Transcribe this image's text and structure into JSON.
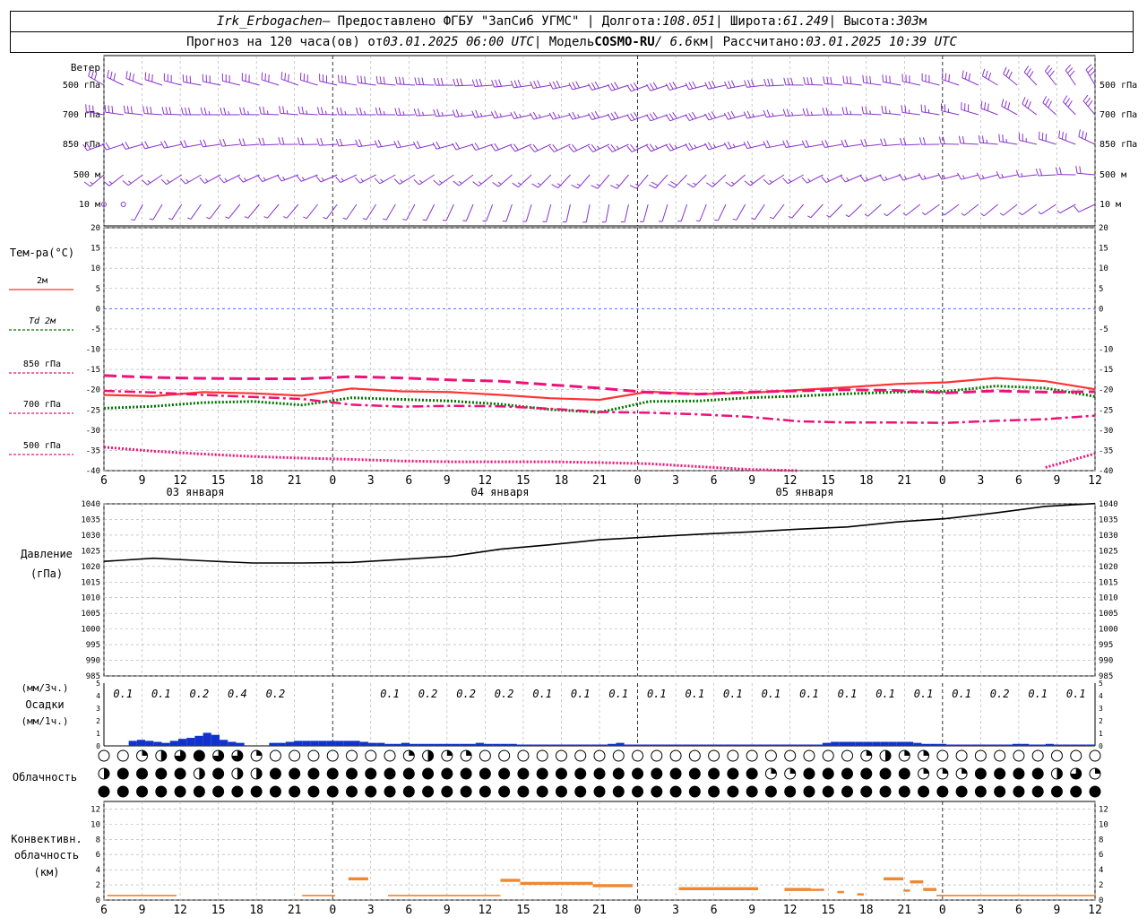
{
  "header": {
    "station": "Irk_Erbogachen",
    "provider_prefix": " – Предоставлено ФГБУ \"ЗапСиб УГМС\" | Долгота: ",
    "longitude": "108.051",
    "lat_prefix": " | Широта: ",
    "latitude": "61.249",
    "alt_prefix": " | Высота: ",
    "altitude": "303",
    "alt_unit": "м",
    "forecast_prefix": "Прогноз на 120 часа(ов) от ",
    "forecast_start": "03.01.2025 06:00 UTC",
    "model_prefix": " | Модель ",
    "model": "COSMO-RU",
    "resolution": " / 6.6",
    "res_unit": "км",
    "calc_prefix": " | Рассчитано: ",
    "calc_time": "03.01.2025 10:39 UTC"
  },
  "labels": {
    "wind": "Ветер",
    "levels": [
      "500 гПа",
      "700 гПа",
      "850 гПа",
      "500 м",
      "10 м"
    ],
    "temp_title": "Тем-ра(°C)",
    "legend": [
      {
        "label": "2м",
        "color": "#ff3333",
        "dash": "solid"
      },
      {
        "label": "Td 2м",
        "color": "#007700",
        "dash": "dotted"
      },
      {
        "label": "850 гПа",
        "color": "#ee1177",
        "dash": "dash"
      },
      {
        "label": "700 гПа",
        "color": "#ee1177",
        "dash": "dashdot"
      },
      {
        "label": "500 гПа",
        "color": "#ee1177",
        "dash": "dot"
      }
    ],
    "pressure_title": "Давление",
    "pressure_unit": "(гПа)",
    "precip_unit3": "(мм/3ч.)",
    "precip_title": "Осадки",
    "precip_unit1": "(мм/1ч.)",
    "cloud_title": "Облачность",
    "conv_title1": "Конвективн.",
    "conv_title2": "облачность",
    "conv_unit": "(км)"
  },
  "time_axis": {
    "ticks": [
      "6",
      "9",
      "12",
      "15",
      "18",
      "21",
      "0",
      "3",
      "6",
      "9",
      "12",
      "15",
      "18",
      "21",
      "0",
      "3",
      "6",
      "9",
      "12",
      "15",
      "18",
      "21",
      "0",
      "3",
      "6",
      "9",
      "12"
    ],
    "dates": [
      "03 января",
      "04 января",
      "05 января"
    ]
  },
  "chart_data": [
    {
      "type": "line",
      "name": "temperature",
      "ylim": [
        -40,
        20
      ],
      "yticks": [
        20,
        15,
        10,
        5,
        0,
        -5,
        -10,
        -15,
        -20,
        -25,
        -30,
        -35,
        -40
      ],
      "hours": [
        0,
        6,
        12,
        18,
        24,
        30,
        36,
        42,
        48,
        54,
        60,
        66,
        72,
        78,
        84,
        90,
        96,
        102,
        108,
        114,
        120
      ],
      "series": [
        {
          "name": "2м",
          "values": [
            -21.3,
            -21.6,
            -20.6,
            -20.9,
            -21.5,
            -19.7,
            -20.4,
            -20.6,
            -21.3,
            -22.1,
            -22.5,
            -20.5,
            -21.1,
            -20.8,
            -20.1,
            -19.4,
            -18.6,
            -18.2,
            -17.1,
            -17.9,
            -19.9
          ]
        },
        {
          "name": "Td 2м",
          "values": [
            -24.6,
            -24.1,
            -23.2,
            -22.9,
            -23.8,
            -22.0,
            -22.4,
            -22.8,
            -23.6,
            -24.9,
            -25.6,
            -22.9,
            -22.8,
            -22.0,
            -21.6,
            -21.0,
            -20.6,
            -20.4,
            -19.1,
            -19.6,
            -21.7
          ]
        },
        {
          "name": "850 гПа",
          "values": [
            -16.5,
            -17.0,
            -17.2,
            -17.3,
            -17.3,
            -16.8,
            -17.1,
            -17.6,
            -17.9,
            -18.8,
            -19.6,
            -20.7,
            -21.1,
            -20.6,
            -20.3,
            -20.0,
            -20.2,
            -20.8,
            -20.3,
            -20.6,
            -20.5
          ]
        },
        {
          "name": "700 гПа",
          "values": [
            -20.3,
            -20.7,
            -21.3,
            -21.8,
            -22.3,
            -23.7,
            -24.2,
            -24.0,
            -24.1,
            -24.7,
            -25.5,
            -25.7,
            -26.1,
            -26.7,
            -27.8,
            -28.1,
            -28.1,
            -28.2,
            -27.7,
            -27.3,
            -26.4
          ]
        },
        {
          "name": "500 гПа",
          "values": [
            -34.2,
            -35.2,
            -35.9,
            -36.5,
            -36.9,
            -37.2,
            -37.6,
            -37.8,
            -37.8,
            -37.8,
            -38.0,
            -38.3,
            -39.0,
            -39.7,
            -40.2,
            null,
            null,
            null,
            null,
            -39.2,
            -35.8
          ]
        }
      ]
    },
    {
      "type": "line",
      "name": "pressure",
      "ylim": [
        985,
        1040
      ],
      "yticks": [
        1040,
        1035,
        1030,
        1025,
        1020,
        1015,
        1010,
        1005,
        1000,
        995,
        990,
        985
      ],
      "hours": [
        0,
        6,
        12,
        18,
        24,
        30,
        36,
        42,
        48,
        54,
        60,
        66,
        72,
        78,
        84,
        90,
        96,
        102,
        108,
        114,
        120
      ],
      "values": [
        1021.6,
        1022.6,
        1021.8,
        1021.1,
        1021.1,
        1021.3,
        1022.2,
        1023.2,
        1025.5,
        1026.9,
        1028.5,
        1029.4,
        1030.3,
        1031.0,
        1031.9,
        1032.6,
        1034.2,
        1035.3,
        1037.1,
        1039.2,
        1040.1
      ]
    },
    {
      "type": "bar",
      "name": "precipitation",
      "ylim": [
        0,
        5
      ],
      "yticks": [
        5,
        4,
        3,
        2,
        1,
        0
      ],
      "three_hour_totals": [
        "0.1",
        "0.1",
        "0.2",
        "0.4",
        "0.2",
        "",
        "",
        "0.1",
        "0.2",
        "0.2",
        "0.2",
        "0.1",
        "0.1",
        "0.1",
        "0.1",
        "0.1",
        "0.1",
        "0.1",
        "0.1",
        "0.1",
        "0.1",
        "0.1",
        "0.1",
        "0.2",
        "0.1",
        "0.1"
      ],
      "hourly_mm": [
        0,
        0,
        0,
        0.05,
        0.06,
        0.05,
        0.04,
        0.03,
        0.05,
        0.07,
        0.08,
        0.1,
        0.13,
        0.11,
        0.06,
        0.04,
        0.03,
        0,
        0,
        0,
        0.03,
        0.03,
        0.04,
        0.05,
        0.05,
        0.05,
        0.05,
        0.05,
        0.05,
        0.05,
        0.05,
        0.04,
        0.03,
        0.03,
        0.02,
        0.02,
        0.03,
        0.02,
        0.02,
        0.02,
        0.02,
        0.02,
        0.02,
        0.02,
        0.02,
        0.03,
        0.02,
        0.02,
        0.02,
        0.02,
        0.01,
        0.01,
        0.01,
        0.01,
        0.01,
        0.01,
        0.01,
        0.01,
        0.01,
        0.01,
        0.01,
        0.02,
        0.03,
        0.01,
        0.01,
        0.01,
        0.01,
        0.01,
        0.01,
        0.01,
        0.01,
        0.01,
        0.01,
        0.01,
        0.01,
        0.01,
        0.01,
        0.01,
        0.01,
        0.01,
        0.01,
        0.01,
        0.01,
        0.01,
        0.01,
        0.01,
        0.01,
        0.03,
        0.04,
        0.04,
        0.04,
        0.04,
        0.04,
        0.04,
        0.04,
        0.04,
        0.04,
        0.04,
        0.03,
        0.02,
        0.02,
        0.02,
        0.01,
        0.01,
        0.01,
        0.01,
        0.01,
        0.01,
        0.01,
        0.01,
        0.02,
        0.02,
        0.01,
        0.01,
        0.02,
        0.01,
        0.01,
        0.01,
        0.01,
        0.01
      ]
    },
    {
      "type": "table",
      "name": "cloudiness",
      "levels": [
        "high",
        "mid",
        "low"
      ],
      "count": 53,
      "legend": "0 clear, 1 quarter, 2 half, 3 three-quarter, 4 overcast",
      "high": [
        0,
        0,
        1,
        2,
        3,
        4,
        3,
        3,
        1,
        0,
        0,
        0,
        0,
        0,
        0,
        0,
        1,
        2,
        1,
        1,
        0,
        0,
        0,
        0,
        0,
        0,
        0,
        0,
        0,
        0,
        0,
        0,
        0,
        0,
        0,
        0,
        0,
        0,
        0,
        0,
        1,
        2,
        1,
        1,
        0,
        0,
        0,
        0,
        0,
        0,
        0,
        0,
        0
      ],
      "mid": [
        2,
        4,
        4,
        4,
        4,
        2,
        4,
        2,
        2,
        4,
        4,
        4,
        4,
        4,
        4,
        4,
        4,
        4,
        4,
        4,
        4,
        4,
        4,
        4,
        4,
        4,
        4,
        4,
        4,
        4,
        4,
        4,
        4,
        4,
        4,
        1,
        1,
        4,
        4,
        4,
        4,
        4,
        4,
        1,
        1,
        1,
        4,
        4,
        4,
        4,
        2,
        3,
        1
      ],
      "low": [
        4,
        4,
        4,
        4,
        4,
        4,
        4,
        4,
        4,
        4,
        4,
        4,
        4,
        4,
        4,
        4,
        4,
        4,
        4,
        4,
        4,
        4,
        4,
        4,
        4,
        4,
        4,
        4,
        4,
        4,
        4,
        4,
        4,
        4,
        4,
        4,
        4,
        4,
        4,
        4,
        4,
        4,
        4,
        4,
        4,
        4,
        4,
        4,
        4,
        4,
        4,
        4,
        4
      ]
    },
    {
      "type": "bar",
      "name": "convective_cloud",
      "ylim": [
        0,
        13
      ],
      "yticks": [
        12,
        10,
        8,
        6,
        4,
        2,
        0
      ],
      "segments": [
        {
          "from": 0.5,
          "to": 11,
          "base": 0.5,
          "top": 0.7
        },
        {
          "from": 30,
          "to": 35,
          "base": 0.5,
          "top": 0.7
        },
        {
          "from": 37,
          "to": 40,
          "base": 2.6,
          "top": 3.0
        },
        {
          "from": 43,
          "to": 60,
          "base": 0.5,
          "top": 0.7
        },
        {
          "from": 60,
          "to": 63,
          "base": 2.4,
          "top": 2.8
        },
        {
          "from": 63,
          "to": 74,
          "base": 2.0,
          "top": 2.4
        },
        {
          "from": 74,
          "to": 80,
          "base": 1.7,
          "top": 2.1
        },
        {
          "from": 87,
          "to": 99,
          "base": 1.3,
          "top": 1.7
        },
        {
          "from": 103,
          "to": 107,
          "base": 1.2,
          "top": 1.6
        },
        {
          "from": 107,
          "to": 109,
          "base": 1.2,
          "top": 1.5
        },
        {
          "from": 111,
          "to": 112,
          "base": 0.9,
          "top": 1.2
        },
        {
          "from": 114,
          "to": 115,
          "base": 0.6,
          "top": 0.9
        },
        {
          "from": 118,
          "to": 121,
          "base": 2.6,
          "top": 3.0
        },
        {
          "from": 121,
          "to": 122,
          "base": 1.1,
          "top": 1.4
        },
        {
          "from": 122,
          "to": 124,
          "base": 2.2,
          "top": 2.6
        },
        {
          "from": 124,
          "to": 126,
          "base": 1.2,
          "top": 1.6
        },
        {
          "from": 126,
          "to": 150,
          "base": 0.5,
          "top": 0.7
        }
      ]
    },
    {
      "type": "scatter",
      "name": "wind_barbs",
      "note": "speed in m/s, direction in degrees (from)",
      "hours": [
        0,
        6,
        12,
        18,
        24,
        30,
        36,
        42,
        48,
        54,
        60,
        66,
        72,
        78,
        84,
        90,
        96,
        102,
        108,
        114,
        120
      ],
      "levels": {
        "500 гПа": {
          "dir": [
            300,
            290,
            280,
            285,
            290,
            280,
            275,
            270,
            265,
            260,
            255,
            250,
            255,
            260,
            270,
            275,
            280,
            285,
            300,
            320,
            330
          ],
          "spd": [
            22,
            20,
            18,
            17,
            16,
            16,
            15,
            14,
            14,
            15,
            16,
            17,
            16,
            15,
            14,
            14,
            14,
            13,
            15,
            19,
            22
          ]
        },
        "700 гПа": {
          "dir": [
            280,
            275,
            270,
            270,
            275,
            270,
            270,
            265,
            260,
            255,
            255,
            250,
            250,
            255,
            265,
            270,
            275,
            280,
            290,
            310,
            320
          ],
          "spd": [
            12,
            11,
            11,
            10,
            10,
            10,
            10,
            9,
            9,
            10,
            11,
            12,
            12,
            11,
            10,
            10,
            10,
            10,
            12,
            14,
            16
          ]
        },
        "850 гПа": {
          "dir": [
            250,
            255,
            260,
            265,
            270,
            265,
            260,
            255,
            250,
            245,
            245,
            245,
            250,
            255,
            260,
            260,
            265,
            270,
            275,
            285,
            295
          ],
          "spd": [
            8,
            8,
            8,
            7,
            7,
            7,
            7,
            7,
            7,
            8,
            9,
            9,
            9,
            9,
            8,
            8,
            8,
            8,
            9,
            11,
            12
          ]
        },
        "500 м": {
          "dir": [
            230,
            235,
            240,
            245,
            250,
            245,
            240,
            235,
            230,
            225,
            220,
            220,
            225,
            230,
            240,
            245,
            250,
            255,
            255,
            265,
            275
          ],
          "spd": [
            6,
            6,
            6,
            5,
            5,
            5,
            5,
            5,
            5,
            6,
            6,
            7,
            7,
            6,
            6,
            6,
            6,
            6,
            6,
            7,
            8
          ]
        },
        "10 м": {
          "dir": [
            200,
            210,
            215,
            220,
            220,
            215,
            210,
            205,
            200,
            195,
            190,
            195,
            200,
            210,
            220,
            225,
            230,
            235,
            230,
            235,
            245
          ],
          "spd": [
            1,
            2,
            2,
            2,
            2,
            2,
            2,
            2,
            2,
            2,
            2,
            2,
            2,
            2,
            2,
            2,
            2,
            2,
            2,
            2,
            3
          ]
        }
      }
    }
  ],
  "colors": {
    "t2m": "#ff3333",
    "td2m": "#007700",
    "upper": "#ee1177",
    "pressure": "#000000",
    "precip": "#1133cc",
    "conv": "#ee8833",
    "wind": "#8833cc",
    "zero_line": "#3355ff",
    "grid": "#aaaaaa"
  }
}
